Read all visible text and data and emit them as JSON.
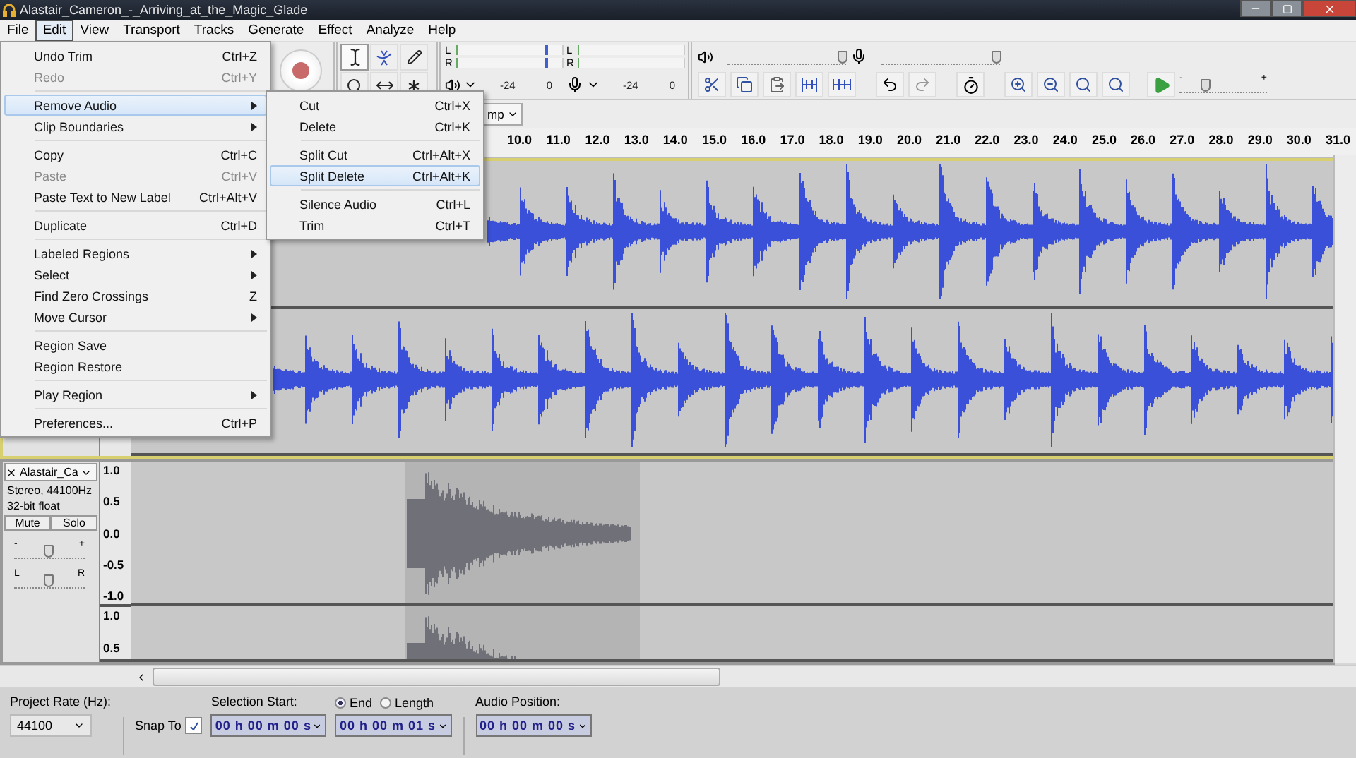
{
  "window": {
    "title": "Alastair_Cameron_-_Arriving_at_the_Magic_Glade"
  },
  "menu_bar": [
    {
      "label": "File",
      "selected": false
    },
    {
      "label": "Edit",
      "selected": true
    },
    {
      "label": "View",
      "selected": false
    },
    {
      "label": "Transport",
      "selected": false
    },
    {
      "label": "Tracks",
      "selected": false
    },
    {
      "label": "Generate",
      "selected": false
    },
    {
      "label": "Effect",
      "selected": false
    },
    {
      "label": "Analyze",
      "selected": false
    },
    {
      "label": "Help",
      "selected": false
    }
  ],
  "edit_menu": {
    "groups": [
      [
        {
          "label": "Undo Trim",
          "shortcut": "Ctrl+Z",
          "disabled": false,
          "submenu": false,
          "selected": false
        },
        {
          "label": "Redo",
          "shortcut": "Ctrl+Y",
          "disabled": true,
          "submenu": false,
          "selected": false
        }
      ],
      [
        {
          "label": "Remove Audio",
          "disabled": false,
          "submenu": true,
          "selected": true
        },
        {
          "label": "Clip Boundaries",
          "disabled": false,
          "submenu": true,
          "selected": false
        }
      ],
      [
        {
          "label": "Copy",
          "shortcut": "Ctrl+C",
          "disabled": false,
          "submenu": false,
          "selected": false
        },
        {
          "label": "Paste",
          "shortcut": "Ctrl+V",
          "disabled": true,
          "submenu": false,
          "selected": false
        },
        {
          "label": "Paste Text to New Label",
          "shortcut": "Ctrl+Alt+V",
          "disabled": false,
          "submenu": false,
          "selected": false
        }
      ],
      [
        {
          "label": "Duplicate",
          "shortcut": "Ctrl+D",
          "disabled": false,
          "submenu": false,
          "selected": false
        }
      ],
      [
        {
          "label": "Labeled Regions",
          "disabled": false,
          "submenu": true,
          "selected": false
        },
        {
          "label": "Select",
          "disabled": false,
          "submenu": true,
          "selected": false
        },
        {
          "label": "Find Zero Crossings",
          "shortcut": "Z",
          "disabled": false,
          "submenu": false,
          "selected": false
        },
        {
          "label": "Move Cursor",
          "disabled": false,
          "submenu": true,
          "selected": false
        }
      ],
      [
        {
          "label": "Region Save",
          "disabled": false,
          "submenu": false,
          "selected": false
        },
        {
          "label": "Region Restore",
          "disabled": false,
          "submenu": false,
          "selected": false
        }
      ],
      [
        {
          "label": "Play Region",
          "disabled": false,
          "submenu": true,
          "selected": false
        }
      ],
      [
        {
          "label": "Preferences...",
          "shortcut": "Ctrl+P",
          "disabled": false,
          "submenu": false,
          "selected": false
        }
      ]
    ]
  },
  "remove_audio_submenu": {
    "groups": [
      [
        {
          "label": "Cut",
          "shortcut": "Ctrl+X",
          "disabled": false,
          "submenu": false,
          "selected": false
        },
        {
          "label": "Delete",
          "shortcut": "Ctrl+K",
          "disabled": false,
          "submenu": false,
          "selected": false
        }
      ],
      [
        {
          "label": "Split Cut",
          "shortcut": "Ctrl+Alt+X",
          "disabled": false,
          "submenu": false,
          "selected": false
        },
        {
          "label": "Split Delete",
          "shortcut": "Ctrl+Alt+K",
          "disabled": false,
          "submenu": false,
          "selected": true
        }
      ],
      [
        {
          "label": "Silence Audio",
          "shortcut": "Ctrl+L",
          "disabled": false,
          "submenu": false,
          "selected": false
        },
        {
          "label": "Trim",
          "shortcut": "Ctrl+T",
          "disabled": false,
          "submenu": false,
          "selected": false
        }
      ]
    ]
  },
  "meters": [
    {
      "kind": "playback",
      "channels": [
        "L",
        "R"
      ],
      "scale": [
        "-24",
        "0"
      ]
    },
    {
      "kind": "recording",
      "channels": [
        "L",
        "R"
      ],
      "scale": [
        "-24",
        "0"
      ]
    }
  ],
  "mixer": {
    "output_volume": {
      "level": 0.98
    },
    "input_volume": {
      "level": 0.98
    }
  },
  "play_at_speed": {
    "level": 0.3,
    "min": "-",
    "max": "+"
  },
  "dropdown_fragment": "mp",
  "timeline": {
    "ticks": [
      "10.0",
      "11.0",
      "12.0",
      "13.0",
      "14.0",
      "15.0",
      "16.0",
      "17.0",
      "18.0",
      "19.0",
      "20.0",
      "21.0",
      "22.0",
      "23.0",
      "24.0",
      "25.0",
      "26.0",
      "27.0",
      "28.0",
      "29.0",
      "30.0",
      "31.0"
    ]
  },
  "tracks": [
    {
      "kind": "blue",
      "selected": true
    },
    {
      "kind": "grey",
      "selected": false,
      "name": "Alastair_Ca",
      "format": "Stereo, 44100Hz",
      "bit_depth": "32-bit float",
      "mute": "Mute",
      "solo": "Solo",
      "gain": {
        "level": 0.5,
        "min": "-",
        "max": "+"
      },
      "pan": {
        "level": 0.5,
        "left": "L",
        "right": "R"
      },
      "scale": [
        [
          "1.0",
          "0.5",
          "0.0",
          "-0.5",
          "-1.0"
        ],
        [
          "1.0",
          "0.5"
        ]
      ]
    }
  ],
  "selection_bar": {
    "project_rate_label": "Project Rate (Hz):",
    "project_rate": "44100",
    "snap_to": {
      "label": "Snap To",
      "checked": true
    },
    "selection_start_label": "Selection Start:",
    "selection_start": "00 h 00 m 00 s",
    "end_options": [
      {
        "label": "End",
        "selected": true
      },
      {
        "label": "Length",
        "selected": false
      }
    ],
    "end_value": "00 h 00 m 01 s",
    "audio_position_label": "Audio Position:",
    "audio_position": "00 h 00 m 00 s"
  }
}
